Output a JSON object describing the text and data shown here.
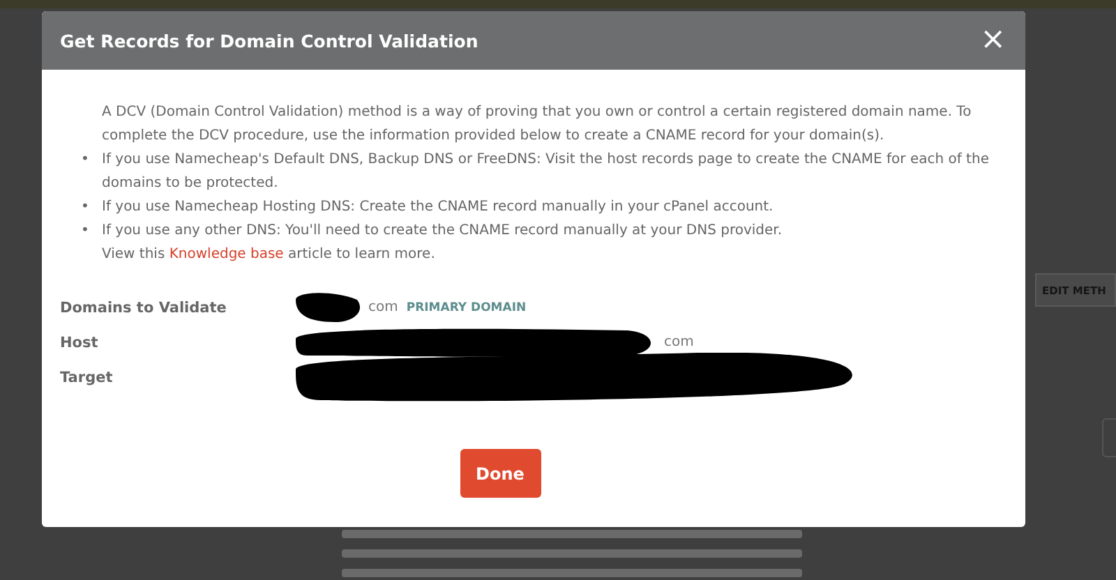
{
  "background": {
    "button_label": "EDIT METH"
  },
  "dialog": {
    "title": "Get Records for Domain Control Validation",
    "close": "×",
    "intro": "A DCV (Domain Control Validation) method is a way of proving that you own or control a certain registered domain name. To complete the DCV procedure, use the information provided below to create a CNAME record for your domain(s).",
    "bullet_marker": "•",
    "bullets": [
      "If you use Namecheap's Default DNS, Backup DNS or FreeDNS: Visit the host records page to create the CNAME for each of the domains to be protected.",
      "If you use Namecheap Hosting DNS: Create the CNAME record manually in your cPanel account.",
      "If you use any other DNS: You'll need to create the CNAME record manually at your DNS provider."
    ],
    "note": {
      "before": "View this ",
      "link": "Knowledge base",
      "after": " article to learn more."
    },
    "fields": [
      {
        "label": "Domains to Validate",
        "value": "com",
        "badge": "PRIMARY DOMAIN"
      },
      {
        "label": "Host",
        "value": "com"
      },
      {
        "label": "Target"
      }
    ],
    "done": "Done"
  }
}
